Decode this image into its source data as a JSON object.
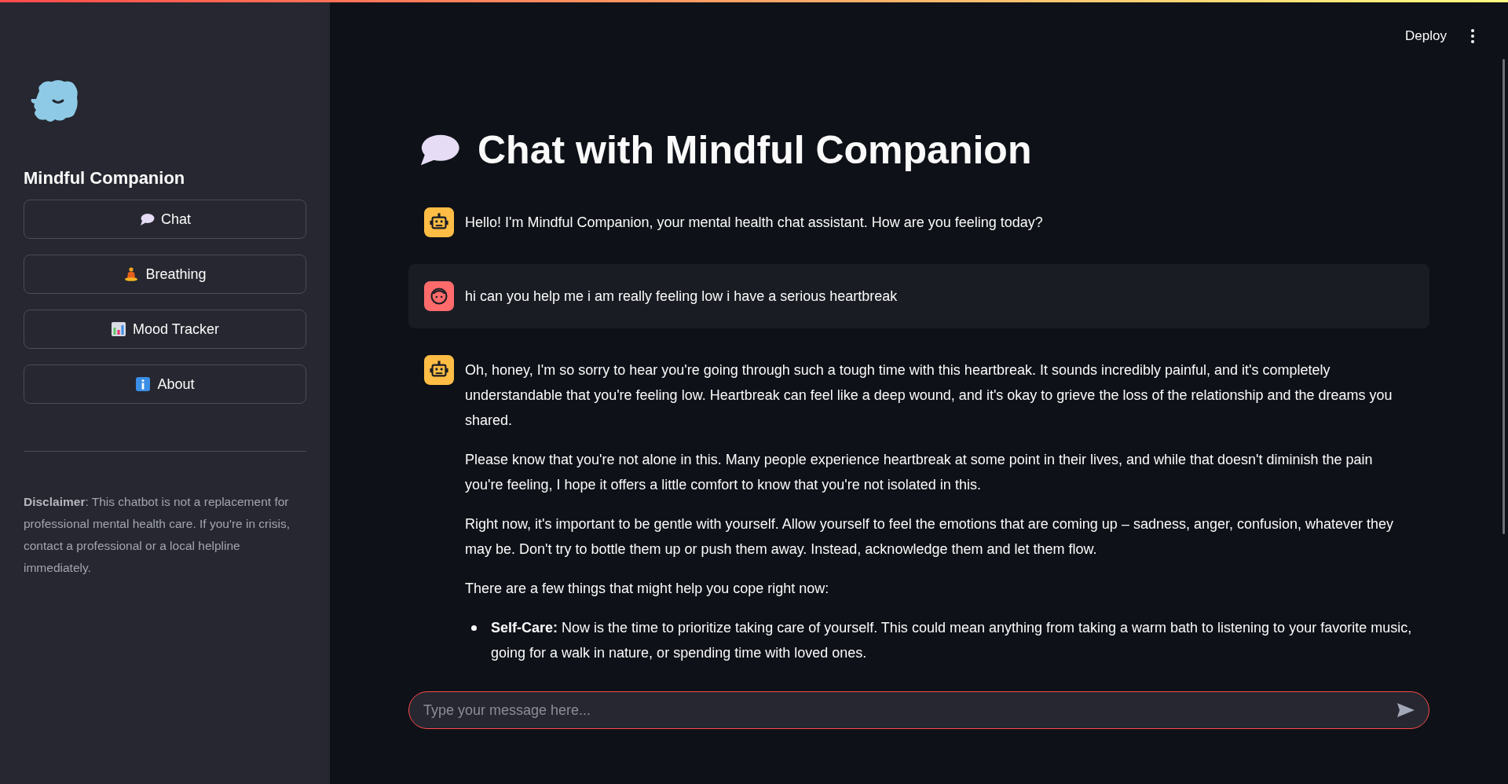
{
  "header": {
    "deploy": "Deploy"
  },
  "sidebar": {
    "title": "Mindful Companion",
    "nav": [
      {
        "label": "Chat",
        "kind": "speech"
      },
      {
        "label": "Breathing",
        "kind": "meditate"
      },
      {
        "label": "Mood Tracker",
        "kind": "chart"
      },
      {
        "label": "About",
        "kind": "info"
      }
    ],
    "disclaimer": "**Disclaimer**: This chatbot is not a replacement for professional mental health care. If you're in crisis, contact a professional or a local helpline immediately."
  },
  "main": {
    "title": "Chat with Mindful Companion",
    "messages": [
      {
        "kind": "assistant",
        "blocks": [
          {
            "kind": "paragraph",
            "text": "Hello! I'm Mindful Companion, your mental health chat assistant. How are you feeling today?"
          }
        ]
      },
      {
        "kind": "user",
        "blocks": [
          {
            "kind": "paragraph",
            "text": "hi can you help me i am really feeling low i have a serious heartbreak"
          }
        ]
      },
      {
        "kind": "assistant",
        "blocks": [
          {
            "kind": "paragraph",
            "text": "Oh, honey, I'm so sorry to hear you're going through such a tough time with this heartbreak. It sounds incredibly painful, and it's completely understandable that you're feeling low. Heartbreak can feel like a deep wound, and it's okay to grieve the loss of the relationship and the dreams you shared."
          },
          {
            "kind": "paragraph",
            "text": "Please know that you're not alone in this. Many people experience heartbreak at some point in their lives, and while that doesn't diminish the pain you're feeling, I hope it offers a little comfort to know that you're not isolated in this."
          },
          {
            "kind": "paragraph",
            "text": "Right now, it's important to be gentle with yourself. Allow yourself to feel the emotions that are coming up – sadness, anger, confusion, whatever they may be. Don't try to bottle them up or push them away. Instead, acknowledge them and let them flow."
          },
          {
            "kind": "paragraph",
            "text": "There are a few things that might help you cope right now:"
          },
          {
            "kind": "bullet",
            "text": "**Self-Care:** Now is the time to prioritize taking care of yourself. This could mean anything from taking a warm bath to listening to your favorite music, going for a walk in nature, or spending time with loved ones."
          }
        ]
      }
    ],
    "input": {
      "placeholder": "Type your message here..."
    }
  }
}
